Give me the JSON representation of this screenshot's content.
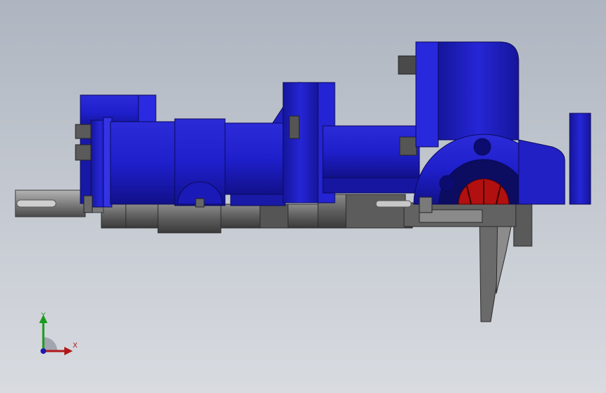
{
  "viewport": {
    "background_top": "#aeb5c0",
    "background_bottom": "#d8dbe0"
  },
  "colors": {
    "part_blue": "#1f1fcc",
    "part_blue_dark": "#0d0d7a",
    "part_blue_light": "#3a3aee",
    "steel": "#6e6e6e",
    "steel_dark": "#3c3c3c",
    "steel_light": "#9a9a9a",
    "impeller_red": "#b21010"
  },
  "triad": {
    "x_label": "X",
    "y_label": "Y",
    "x_color": "#b01818",
    "y_color": "#1a9a1a",
    "z_color": "#1a1ab0"
  }
}
